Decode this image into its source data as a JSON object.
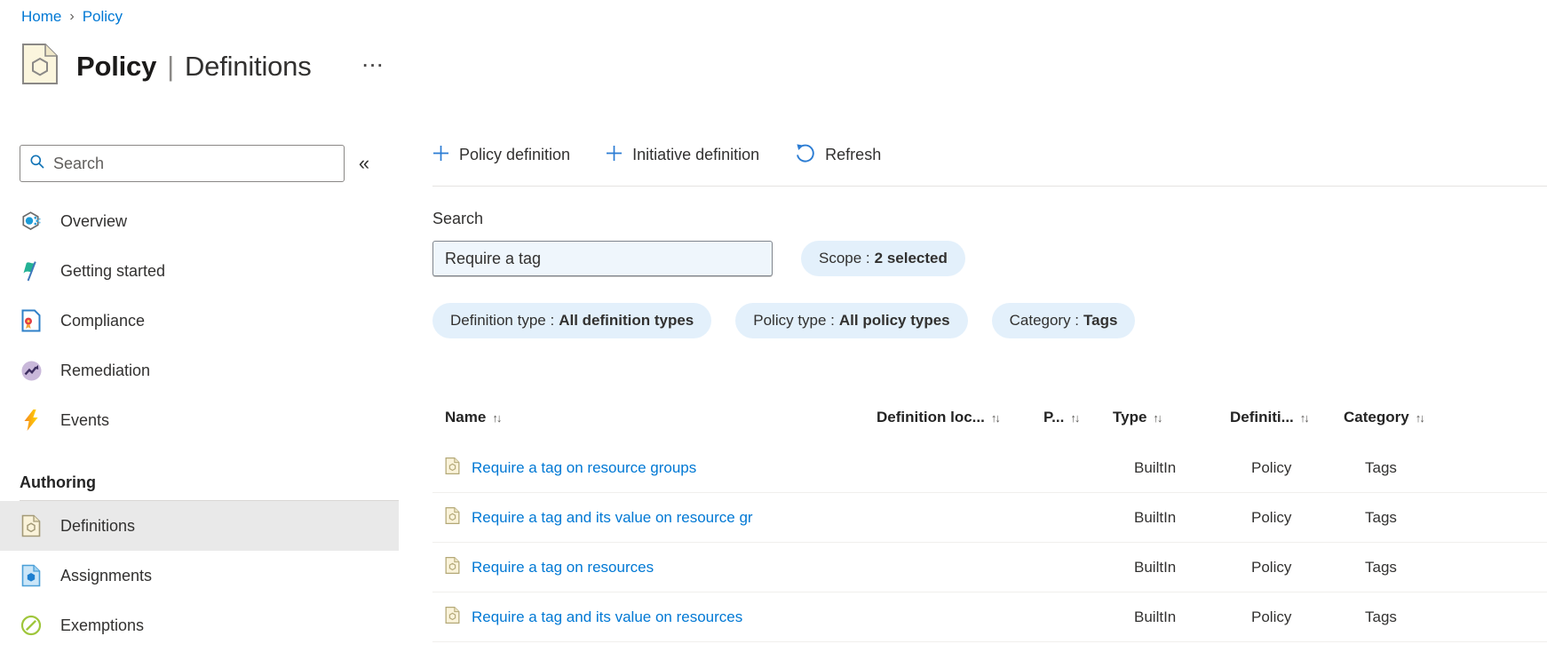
{
  "breadcrumb": {
    "home": "Home",
    "policy": "Policy",
    "separator": "›"
  },
  "header": {
    "title_primary": "Policy",
    "title_separator": "|",
    "title_secondary": "Definitions",
    "more_glyph": "···"
  },
  "sidebar": {
    "search_placeholder": "Search",
    "collapse_glyph": "«",
    "items": [
      {
        "label": "Overview"
      },
      {
        "label": "Getting started"
      },
      {
        "label": "Compliance"
      },
      {
        "label": "Remediation"
      },
      {
        "label": "Events"
      }
    ],
    "section_label": "Authoring",
    "authoring_items": [
      {
        "label": "Definitions",
        "selected": true
      },
      {
        "label": "Assignments",
        "selected": false
      },
      {
        "label": "Exemptions",
        "selected": false
      }
    ]
  },
  "toolbar": {
    "policy_definition": "Policy definition",
    "initiative_definition": "Initiative definition",
    "refresh": "Refresh"
  },
  "filters": {
    "search_label": "Search",
    "search_value": "Require a tag",
    "scope_label": "Scope :",
    "scope_value": "2 selected",
    "pills": [
      {
        "label": "Definition type :",
        "value": "All definition types"
      },
      {
        "label": "Policy type :",
        "value": "All policy types"
      },
      {
        "label": "Category :",
        "value": "Tags"
      }
    ]
  },
  "table": {
    "sort_glyph": "↑↓",
    "columns": [
      "Name",
      "Definition loc...",
      "P...",
      "Type",
      "Definiti...",
      "Category"
    ],
    "rows": [
      {
        "name": "Require a tag on resource groups",
        "type": "BuiltIn",
        "definition": "Policy",
        "category": "Tags"
      },
      {
        "name": "Require a tag and its value on resource gr",
        "type": "BuiltIn",
        "definition": "Policy",
        "category": "Tags"
      },
      {
        "name": "Require a tag on resources",
        "type": "BuiltIn",
        "definition": "Policy",
        "category": "Tags"
      },
      {
        "name": "Require a tag and its value on resources",
        "type": "BuiltIn",
        "definition": "Policy",
        "category": "Tags"
      }
    ]
  },
  "colors": {
    "accent": "#0078d4",
    "pill_bg": "#e3f0fb",
    "input_bg": "#eff6fc",
    "selected_item_bg": "#e9e9e9",
    "text": "#323130"
  }
}
